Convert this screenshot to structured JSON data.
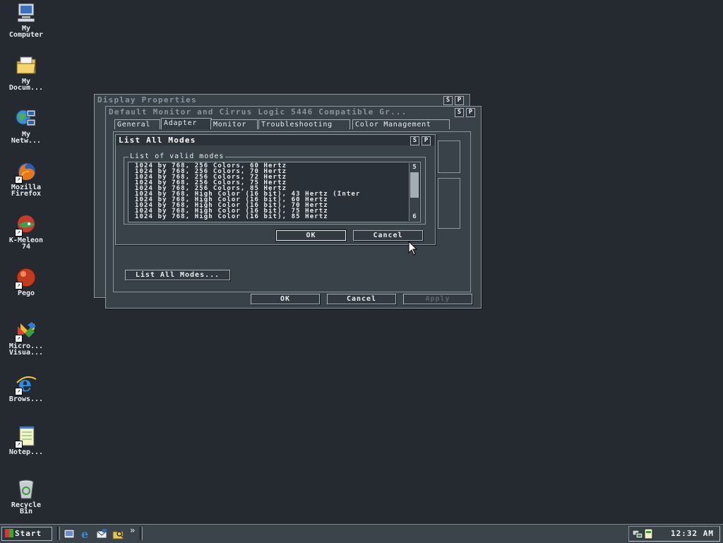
{
  "desktop": {
    "icons": [
      {
        "label": "My\nComputer",
        "icon": "computer-icon",
        "shortcut": false
      },
      {
        "label": "My\nDocum...",
        "icon": "documents-folder-icon",
        "shortcut": false
      },
      {
        "label": "My\nNetw...",
        "icon": "network-icon",
        "shortcut": false
      },
      {
        "label": "Mozilla\nFirefox",
        "icon": "firefox-icon",
        "shortcut": true
      },
      {
        "label": "K-Meleon\n74",
        "icon": "kmeleon-icon",
        "shortcut": true
      },
      {
        "label": "Pego",
        "icon": "pego-icon",
        "shortcut": true
      },
      {
        "label": "Micro...\nVisua...",
        "icon": "visual-studio-icon",
        "shortcut": true
      },
      {
        "label": "Brows...",
        "icon": "internet-explorer-icon",
        "shortcut": true
      },
      {
        "label": "Notep...",
        "icon": "notepad-icon",
        "shortcut": true
      },
      {
        "label": "Recycle\nBin",
        "icon": "recycle-bin-icon",
        "shortcut": false
      }
    ]
  },
  "display_properties": {
    "title": "Display Properties",
    "btn_s": "S",
    "btn_p": "P"
  },
  "adapter_window": {
    "title": "Default Monitor and Cirrus Logic 5446 Compatible Gr...",
    "btn_s": "S",
    "btn_p": "P",
    "tabs": [
      "General",
      "Adapter",
      "Monitor",
      "Troubleshooting",
      "Color Management"
    ],
    "selected_tab": "Adapter",
    "list_all_modes_button": "List All Modes...",
    "ok": "OK",
    "cancel": "Cancel",
    "apply": "Apply"
  },
  "modes_dialog": {
    "title": "List All Modes",
    "btn_s": "S",
    "btn_p": "P",
    "group_label": "List of valid modes",
    "modes": [
      "1024 by 768, 256 Colors, 60 Hertz",
      "1024 by 768, 256 Colors, 70 Hertz",
      "1024 by 768, 256 Colors, 72 Hertz",
      "1024 by 768, 256 Colors, 75 Hertz",
      "1024 by 768, 256 Colors, 85 Hertz",
      "1024 by 768, High Color (16 bit), 43 Hertz (Inter",
      "1024 by 768, High Color (16 bit), 60 Hertz",
      "1024 by 768, High Color (16 bit), 70 Hertz",
      "1024 by 768, High Color (16 bit), 75 Hertz",
      "1024 by 768, High Color (16 bit), 85 Hertz"
    ],
    "scroll_up": "5",
    "scroll_down": "6",
    "ok": "OK",
    "cancel": "Cancel"
  },
  "taskbar": {
    "start_label": "Start",
    "overflow": "»",
    "clock": "12:32 AM",
    "quick_launch": [
      "desktop-icon",
      "ie-icon",
      "outlook-icon",
      "explorer-icon"
    ]
  }
}
